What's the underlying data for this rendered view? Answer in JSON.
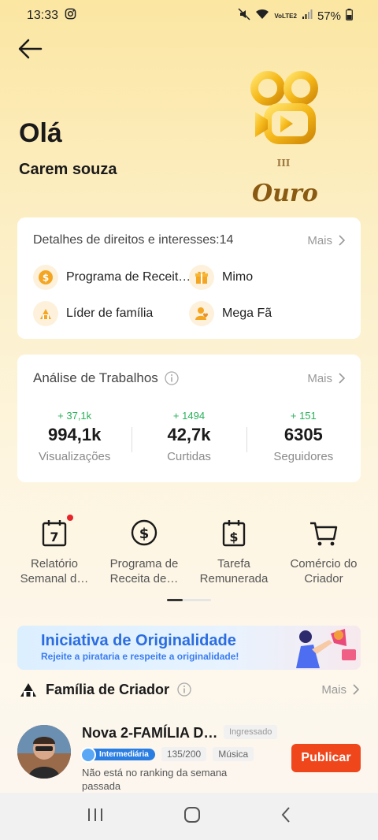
{
  "status": {
    "time": "13:33",
    "battery": "57%",
    "network": "VoLTE2"
  },
  "header": {
    "greeting": "Olá",
    "username": "Carem souza",
    "badge_rank": "III",
    "badge_level": "Ouro"
  },
  "rights": {
    "title": "Detalhes de direitos e interesses:14",
    "more": "Mais",
    "items": [
      {
        "label": "Programa de Receit…",
        "icon": "dollar-icon"
      },
      {
        "label": "Mimo",
        "icon": "gift-icon"
      },
      {
        "label": "Líder de família",
        "icon": "family-icon"
      },
      {
        "label": "Mega Fã",
        "icon": "fan-icon"
      }
    ]
  },
  "works": {
    "title": "Análise de Trabalhos",
    "more": "Mais",
    "stats": [
      {
        "delta": "+ 37,1k",
        "value": "994,1k",
        "label": "Visualizações"
      },
      {
        "delta": "+ 1494",
        "value": "42,7k",
        "label": "Curtidas"
      },
      {
        "delta": "+ 151",
        "value": "6305",
        "label": "Seguidores"
      }
    ]
  },
  "tools": [
    {
      "label": "Relatório\nSemanal d…",
      "icon": "calendar-7-icon"
    },
    {
      "label": "Programa de\nReceita de…",
      "icon": "dollar-circle-icon"
    },
    {
      "label": "Tarefa\nRemunerada",
      "icon": "calendar-dollar-icon"
    },
    {
      "label": "Comércio do\nCriador",
      "icon": "cart-icon"
    }
  ],
  "banner": {
    "title": "Iniciativa de Originalidade",
    "subtitle": "Rejeite a pirataria e respeite a originalidade!"
  },
  "family": {
    "title": "Família de Criador",
    "more": "Mais",
    "name": "Nova 2-FAMÍLIA D…",
    "status": "Ingressado",
    "level": "Intermediária",
    "members": "135/200",
    "category": "Música",
    "description": "Não está no ranking da semana passada",
    "publish": "Publicar"
  },
  "colors": {
    "accent_red": "#f0461c",
    "positive_green": "#2ab05a",
    "gold": "#f5b819"
  }
}
